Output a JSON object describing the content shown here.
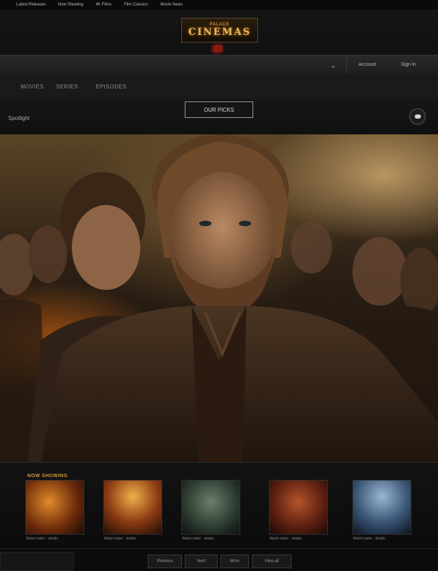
{
  "top_nav": {
    "items": [
      "Latest Releases",
      "Now Showing",
      "4K Films",
      "Film Classics",
      "Movie News"
    ]
  },
  "logo": {
    "small": "PALACE",
    "big": "CINEMAS"
  },
  "main_nav": {
    "links": [
      "Account",
      "Sign In"
    ]
  },
  "tabs": [
    "MOVIES",
    "SERIES",
    "EPISODES"
  ],
  "section_label": "Spotlight",
  "cta_label": "OUR PICKS",
  "shelf": {
    "heading": "NOW SHOWING",
    "cards": [
      {
        "caption": "Watch trailer · details"
      },
      {
        "caption": "Watch trailer · details"
      },
      {
        "caption": "Watch trailer · details"
      },
      {
        "caption": "Watch trailer · details"
      },
      {
        "caption": "Watch trailer · details"
      }
    ]
  },
  "pager": {
    "buttons": [
      "Previous",
      "Next",
      "More",
      "View all"
    ]
  },
  "colors": {
    "accent": "#d39a3c",
    "logo_glow": "#e3b35c",
    "badge": "#8a1a10"
  }
}
